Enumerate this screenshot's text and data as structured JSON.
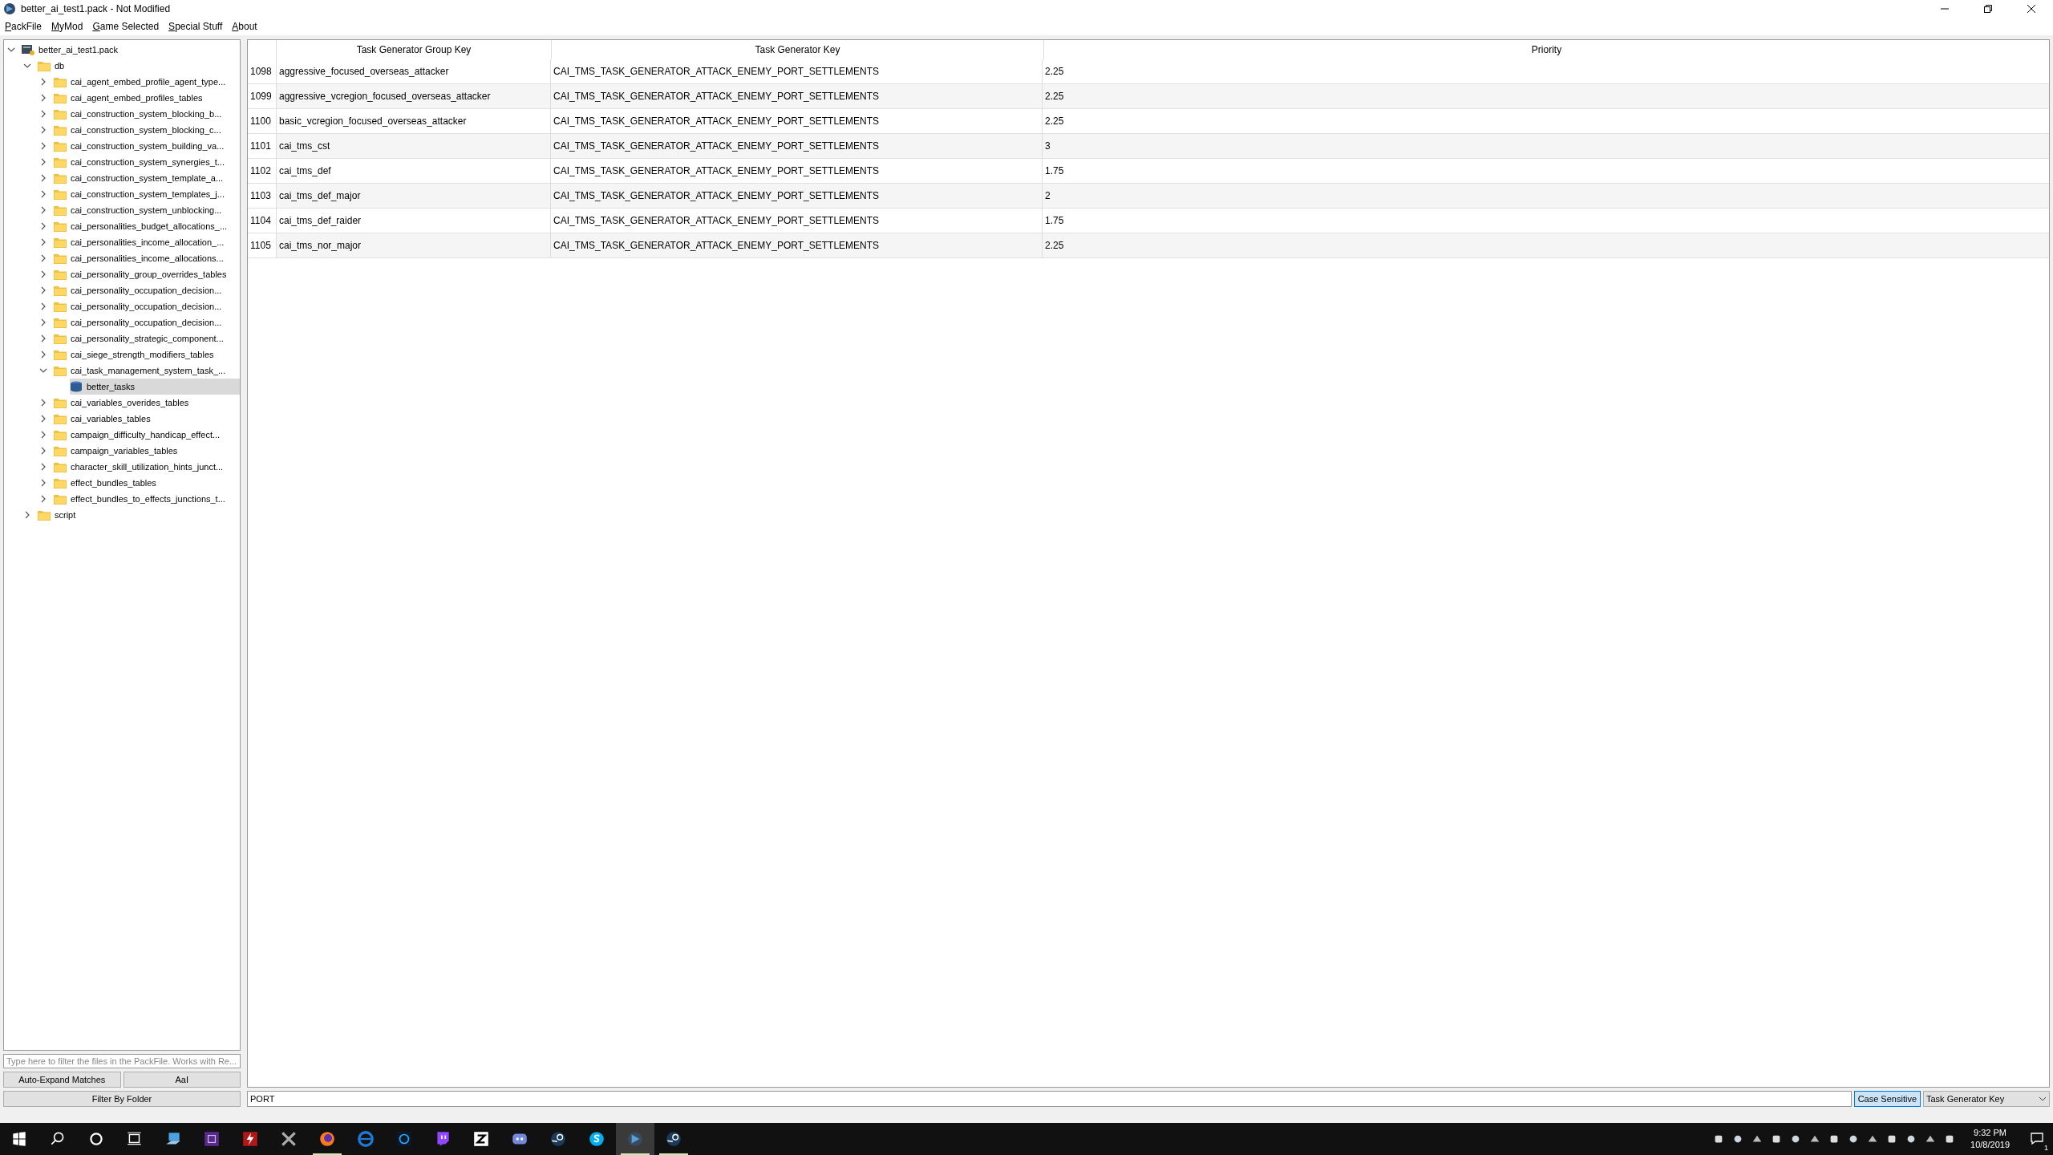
{
  "window": {
    "title": "better_ai_test1.pack - Not Modified"
  },
  "menu": [
    {
      "label": "PackFile"
    },
    {
      "label": "MyMod"
    },
    {
      "label": "Game Selected"
    },
    {
      "label": "Special Stuff"
    },
    {
      "label": "About"
    }
  ],
  "tree": {
    "label": "better_ai_test1.pack",
    "kind": "pack",
    "expanded": true,
    "selected": false,
    "children": [
      {
        "label": "db",
        "kind": "folder",
        "expanded": true,
        "selected": false,
        "children": [
          {
            "label": "cai_agent_embed_profile_agent_type...",
            "kind": "folder",
            "expanded": false,
            "selected": false
          },
          {
            "label": "cai_agent_embed_profiles_tables",
            "kind": "folder",
            "expanded": false,
            "selected": false
          },
          {
            "label": "cai_construction_system_blocking_b...",
            "kind": "folder",
            "expanded": false,
            "selected": false
          },
          {
            "label": "cai_construction_system_blocking_c...",
            "kind": "folder",
            "expanded": false,
            "selected": false
          },
          {
            "label": "cai_construction_system_building_va...",
            "kind": "folder",
            "expanded": false,
            "selected": false
          },
          {
            "label": "cai_construction_system_synergies_t...",
            "kind": "folder",
            "expanded": false,
            "selected": false
          },
          {
            "label": "cai_construction_system_template_a...",
            "kind": "folder",
            "expanded": false,
            "selected": false
          },
          {
            "label": "cai_construction_system_templates_j...",
            "kind": "folder",
            "expanded": false,
            "selected": false
          },
          {
            "label": "cai_construction_system_unblocking...",
            "kind": "folder",
            "expanded": false,
            "selected": false
          },
          {
            "label": "cai_personalities_budget_allocations_...",
            "kind": "folder",
            "expanded": false,
            "selected": false
          },
          {
            "label": "cai_personalities_income_allocation_...",
            "kind": "folder",
            "expanded": false,
            "selected": false
          },
          {
            "label": "cai_personalities_income_allocations...",
            "kind": "folder",
            "expanded": false,
            "selected": false
          },
          {
            "label": "cai_personality_group_overrides_tables",
            "kind": "folder",
            "expanded": false,
            "selected": false
          },
          {
            "label": "cai_personality_occupation_decision...",
            "kind": "folder",
            "expanded": false,
            "selected": false
          },
          {
            "label": "cai_personality_occupation_decision...",
            "kind": "folder",
            "expanded": false,
            "selected": false
          },
          {
            "label": "cai_personality_occupation_decision...",
            "kind": "folder",
            "expanded": false,
            "selected": false
          },
          {
            "label": "cai_personality_strategic_component...",
            "kind": "folder",
            "expanded": false,
            "selected": false
          },
          {
            "label": "cai_siege_strength_modifiers_tables",
            "kind": "folder",
            "expanded": false,
            "selected": false
          },
          {
            "label": "cai_task_management_system_task_...",
            "kind": "folder",
            "expanded": true,
            "selected": false,
            "children": [
              {
                "label": "better_tasks",
                "kind": "table",
                "selected": true
              }
            ]
          },
          {
            "label": "cai_variables_overides_tables",
            "kind": "folder",
            "expanded": false,
            "selected": false
          },
          {
            "label": "cai_variables_tables",
            "kind": "folder",
            "expanded": false,
            "selected": false
          },
          {
            "label": "campaign_difficulty_handicap_effect...",
            "kind": "folder",
            "expanded": false,
            "selected": false
          },
          {
            "label": "campaign_variables_tables",
            "kind": "folder",
            "expanded": false,
            "selected": false
          },
          {
            "label": "character_skill_utilization_hints_junct...",
            "kind": "folder",
            "expanded": false,
            "selected": false
          },
          {
            "label": "effect_bundles_tables",
            "kind": "folder",
            "expanded": false,
            "selected": false
          },
          {
            "label": "effect_bundles_to_effects_junctions_t...",
            "kind": "folder",
            "expanded": false,
            "selected": false
          }
        ]
      },
      {
        "label": "script",
        "kind": "folder",
        "expanded": false,
        "selected": false
      }
    ]
  },
  "file_filter": {
    "placeholder": "Type here to filter the files in the PackFile. Works with Re...",
    "buttons": [
      "Auto-Expand Matches",
      "AaI"
    ],
    "folder_button": "Filter By Folder"
  },
  "table": {
    "columns": [
      "Task Generator Group Key",
      "Task Generator Key",
      "Priority"
    ],
    "rows": [
      {
        "index": "1098",
        "cells": [
          "aggressive_focused_overseas_attacker",
          "CAI_TMS_TASK_GENERATOR_ATTACK_ENEMY_PORT_SETTLEMENTS",
          "2.25"
        ]
      },
      {
        "index": "1099",
        "cells": [
          "aggressive_vcregion_focused_overseas_attacker",
          "CAI_TMS_TASK_GENERATOR_ATTACK_ENEMY_PORT_SETTLEMENTS",
          "2.25"
        ]
      },
      {
        "index": "1100",
        "cells": [
          "basic_vcregion_focused_overseas_attacker",
          "CAI_TMS_TASK_GENERATOR_ATTACK_ENEMY_PORT_SETTLEMENTS",
          "2.25"
        ]
      },
      {
        "index": "1101",
        "cells": [
          "cai_tms_cst",
          "CAI_TMS_TASK_GENERATOR_ATTACK_ENEMY_PORT_SETTLEMENTS",
          "3"
        ]
      },
      {
        "index": "1102",
        "cells": [
          "cai_tms_def",
          "CAI_TMS_TASK_GENERATOR_ATTACK_ENEMY_PORT_SETTLEMENTS",
          "1.75"
        ]
      },
      {
        "index": "1103",
        "cells": [
          "cai_tms_def_major",
          "CAI_TMS_TASK_GENERATOR_ATTACK_ENEMY_PORT_SETTLEMENTS",
          "2"
        ]
      },
      {
        "index": "1104",
        "cells": [
          "cai_tms_def_raider",
          "CAI_TMS_TASK_GENERATOR_ATTACK_ENEMY_PORT_SETTLEMENTS",
          "1.75"
        ]
      },
      {
        "index": "1105",
        "cells": [
          "cai_tms_nor_major",
          "CAI_TMS_TASK_GENERATOR_ATTACK_ENEMY_PORT_SETTLEMENTS",
          "2.25"
        ]
      }
    ]
  },
  "table_filter": {
    "value": "PORT",
    "case_sensitive": {
      "label": "Case Sensitive",
      "selected": true
    },
    "column": "Task Generator Key"
  },
  "taskbar": {
    "apps": [
      {
        "kind": "pc",
        "running": false,
        "selected": false
      },
      {
        "kind": "cpu",
        "running": false,
        "selected": false
      },
      {
        "kind": "bolt",
        "running": false,
        "selected": false
      },
      {
        "kind": "ocx",
        "running": false,
        "selected": false
      },
      {
        "kind": "firefox",
        "running": true,
        "selected": false
      },
      {
        "kind": "edge",
        "running": false,
        "selected": false
      },
      {
        "kind": "battlenet",
        "running": false,
        "selected": false
      },
      {
        "kind": "twitch",
        "running": false,
        "selected": false
      },
      {
        "kind": "z",
        "running": false,
        "selected": false
      },
      {
        "kind": "discord",
        "running": false,
        "selected": false
      },
      {
        "kind": "steam",
        "running": false,
        "selected": false
      },
      {
        "kind": "skype",
        "running": false,
        "selected": false
      },
      {
        "kind": "packtool",
        "running": true,
        "selected": true
      },
      {
        "kind": "steam",
        "running": true,
        "selected": false
      }
    ],
    "time": "9:32 PM",
    "date": "10/8/2019",
    "notifications": "1"
  }
}
